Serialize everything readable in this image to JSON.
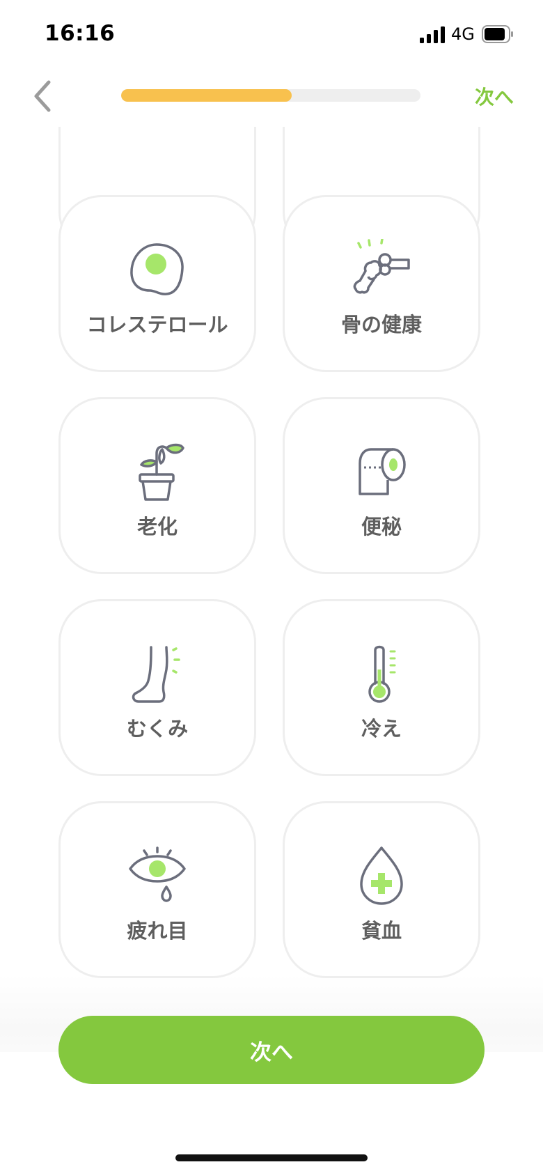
{
  "status_bar": {
    "time": "16:16",
    "network": "4G"
  },
  "header": {
    "next_label": "次へ",
    "progress": 0.57
  },
  "items": [
    {
      "label": "",
      "icon": "partial-card"
    },
    {
      "label": "",
      "icon": "partial-card"
    },
    {
      "label": "コレステロール",
      "icon": "egg-icon"
    },
    {
      "label": "骨の健康",
      "icon": "bone-icon"
    },
    {
      "label": "老化",
      "icon": "wilting-plant-icon"
    },
    {
      "label": "便秘",
      "icon": "toilet-paper-icon"
    },
    {
      "label": "むくみ",
      "icon": "leg-swelling-icon"
    },
    {
      "label": "冷え",
      "icon": "thermometer-icon"
    },
    {
      "label": "疲れ目",
      "icon": "tired-eye-icon"
    },
    {
      "label": "貧血",
      "icon": "blood-drop-icon"
    }
  ],
  "footer": {
    "next_label": "次へ"
  },
  "colors": {
    "accent": "#84c83e",
    "progress": "#f8c14e",
    "icon_stroke": "#6b6e7c",
    "label": "#5e5e5e"
  }
}
